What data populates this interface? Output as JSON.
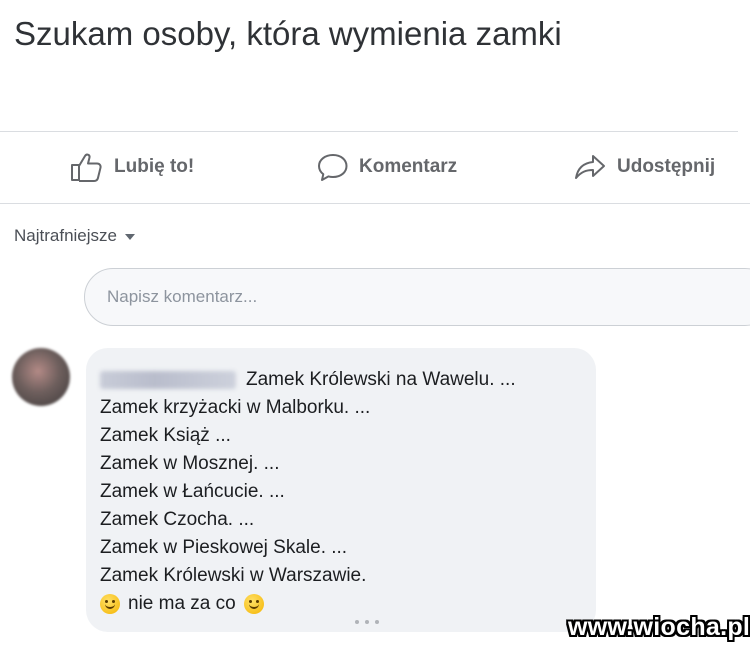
{
  "post": {
    "text": "Szukam osoby, która wymienia zamki"
  },
  "actions": {
    "like_label": "Lubię to!",
    "comment_label": "Komentarz",
    "share_label": "Udostępnij",
    "like_icon": "thumbs-up-icon",
    "comment_icon": "speech-bubble-icon",
    "share_icon": "share-arrow-icon"
  },
  "comments_section": {
    "sort_label": "Najtrafniejsze",
    "input_placeholder": "Napisz komentarz..."
  },
  "comment": {
    "lines": [
      "Zamek Królewski na Wawelu. ...",
      "Zamek krzyżacki w Malborku. ...",
      "Zamek Książ ...",
      "Zamek w Mosznej. ...",
      "Zamek w Łańcucie. ...",
      "Zamek Czocha. ...",
      "Zamek w Pieskowej Skale. ...",
      "Zamek Królewski w Warszawie.",
      "nie ma za co"
    ]
  },
  "watermark": "www.wiocha.pl",
  "colors": {
    "action_text": "#65676b",
    "bubble_bg": "#f0f2f5",
    "divider": "#dadde1"
  }
}
